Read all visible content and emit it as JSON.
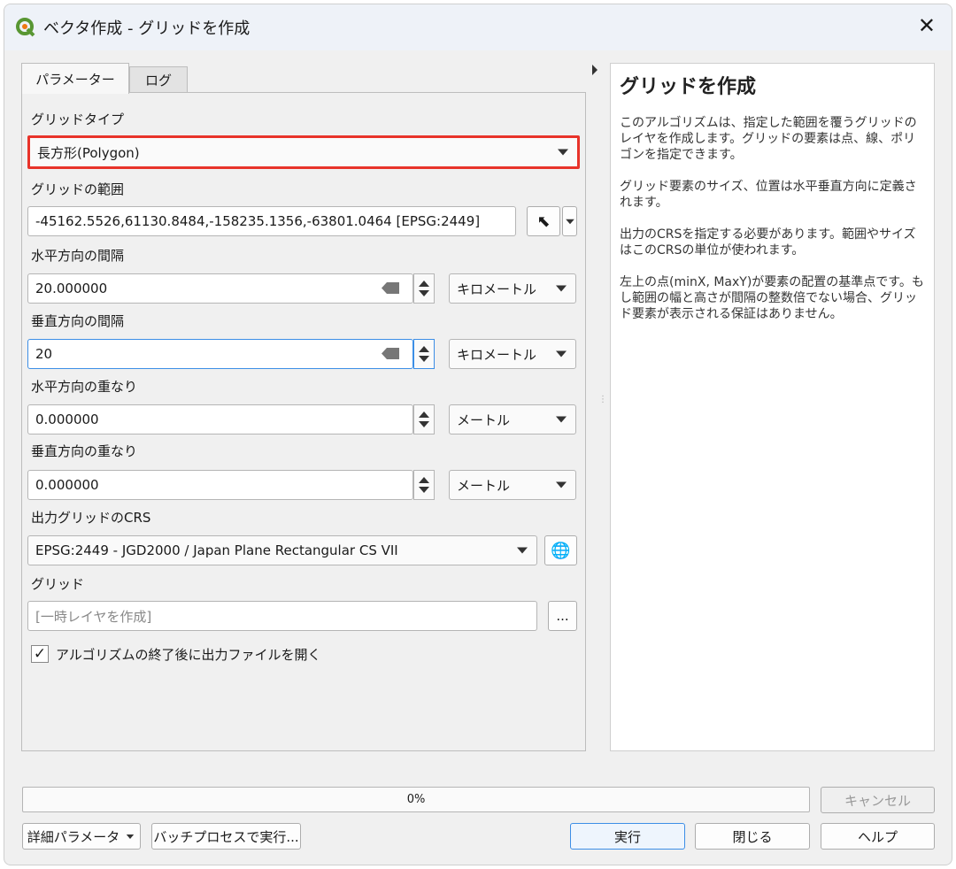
{
  "window": {
    "title": "ベクタ作成 - グリッドを作成",
    "close_icon": "close-icon",
    "app_icon": "qgis-logo-icon"
  },
  "tabs": [
    {
      "label": "パラメーター",
      "active": true
    },
    {
      "label": "ログ",
      "active": false
    }
  ],
  "params": {
    "grid_type": {
      "label": "グリッドタイプ",
      "value": "長方形(Polygon)",
      "highlight_color": "#e8332a"
    },
    "extent": {
      "label": "グリッドの範囲",
      "value": "-45162.5526,61130.8484,-158235.1356,-63801.0464 [EPSG:2449]"
    },
    "h_spacing": {
      "label": "水平方向の間隔",
      "value": "20.000000",
      "unit": "キロメートル"
    },
    "v_spacing": {
      "label": "垂直方向の間隔",
      "value": "20",
      "unit": "キロメートル"
    },
    "h_overlay": {
      "label": "水平方向の重なり",
      "value": "0.000000",
      "unit": "メートル"
    },
    "v_overlay": {
      "label": "垂直方向の重なり",
      "value": "0.000000",
      "unit": "メートル"
    },
    "crs": {
      "label": "出力グリッドのCRS",
      "value": "EPSG:2449 - JGD2000 / Japan Plane Rectangular CS VII"
    },
    "output": {
      "label": "グリッド",
      "placeholder": "[一時レイヤを作成]",
      "browse": "..."
    },
    "open_after": {
      "label": "アルゴリズムの終了後に出力ファイルを開く",
      "checked": true
    }
  },
  "help": {
    "title": "グリッドを作成",
    "paragraphs": [
      "このアルゴリズムは、指定した範囲を覆うグリッドのレイヤを作成します。グリッドの要素は点、線、ポリゴンを指定できます。",
      "グリッド要素のサイズ、位置は水平垂直方向に定義されます。",
      "出力のCRSを指定する必要があります。範囲やサイズはこのCRSの単位が使われます。",
      "左上の点(minX, MaxY)が要素の配置の基準点です。もし範囲の幅と高さが間隔の整数倍でない場合、グリッド要素が表示される保証はありません。"
    ]
  },
  "progress": {
    "percent": 0,
    "label": "0%"
  },
  "buttons": {
    "cancel": "キャンセル",
    "advanced": "詳細パラメータ",
    "batch": "バッチプロセスで実行...",
    "run": "実行",
    "close": "閉じる",
    "help": "ヘルプ"
  }
}
